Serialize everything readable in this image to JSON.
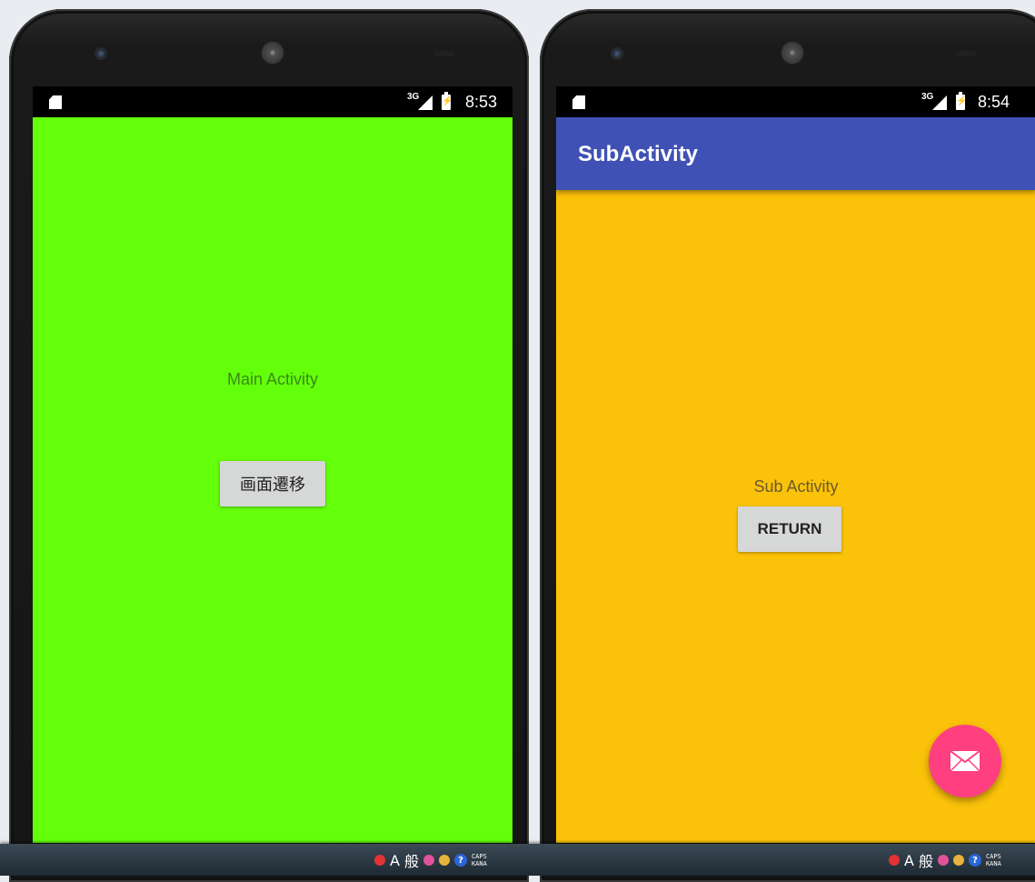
{
  "left_device": {
    "status": {
      "network": "3G",
      "time": "8:53"
    },
    "main": {
      "label": "Main Activity",
      "button": "画面遷移",
      "background": "#64ff0b"
    }
  },
  "right_device": {
    "status": {
      "network": "3G",
      "time": "8:54"
    },
    "appbar": {
      "title": "SubActivity",
      "color": "#3f51b5"
    },
    "main": {
      "label": "Sub Activity",
      "button": "RETURN",
      "background": "#fbc20a"
    },
    "fab": {
      "icon": "mail-icon",
      "color": "#ff3f80"
    }
  },
  "taskbar": {
    "ime_mode": "A",
    "ime_label": "般",
    "caps": "CAPS",
    "kana": "KANA"
  }
}
